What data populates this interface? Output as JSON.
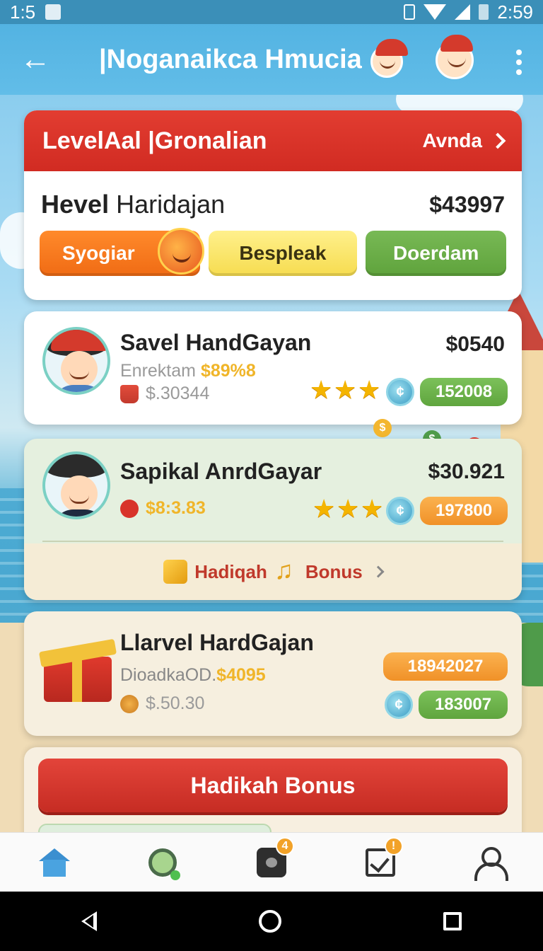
{
  "status_bar": {
    "left_time": "1:5",
    "right_time": "2:59"
  },
  "app_bar": {
    "title": "|Noganaikca Hmucia"
  },
  "level_card": {
    "header_title": "LevelAal |Gronalian",
    "header_link": "Avnda",
    "level_name_bold": "Hevel",
    "level_name_rest": " Haridajan",
    "amount": "$43997",
    "buttons": [
      "Syogiar",
      "Bespleak",
      "Doerdam"
    ]
  },
  "player1": {
    "name": "Savel HandGayan",
    "amount": "$0540",
    "sub_label": "Enrektam ",
    "sub_highlight": "$89%8",
    "sub_value": "$.30344",
    "stars": 3,
    "badge": "152008"
  },
  "player2": {
    "name": "Sapikal AnrdGayar",
    "amount": "$30.921",
    "sub_value": "$8:3.83",
    "stars": 3,
    "badge": "197800",
    "bonus_left": "Hadiqah",
    "bonus_right": "Bonus"
  },
  "player3": {
    "name": "Llarvel HardGajan",
    "sub_label": "DioadkaOD.",
    "sub_highlight": "$4095",
    "sub_value": "$.50.30",
    "badge_orange": "18942027",
    "badge_green": "183007"
  },
  "bonus_button": "Hadikah Bonus",
  "bottom_nav": {
    "items": [
      "home",
      "search",
      "chat",
      "tasks",
      "profile"
    ],
    "chat_badge": "4",
    "tasks_badge": "!"
  },
  "colors": {
    "primary_red": "#d12b22",
    "sky_blue": "#53b3e2",
    "green": "#5fa33c",
    "orange": "#f09128"
  }
}
